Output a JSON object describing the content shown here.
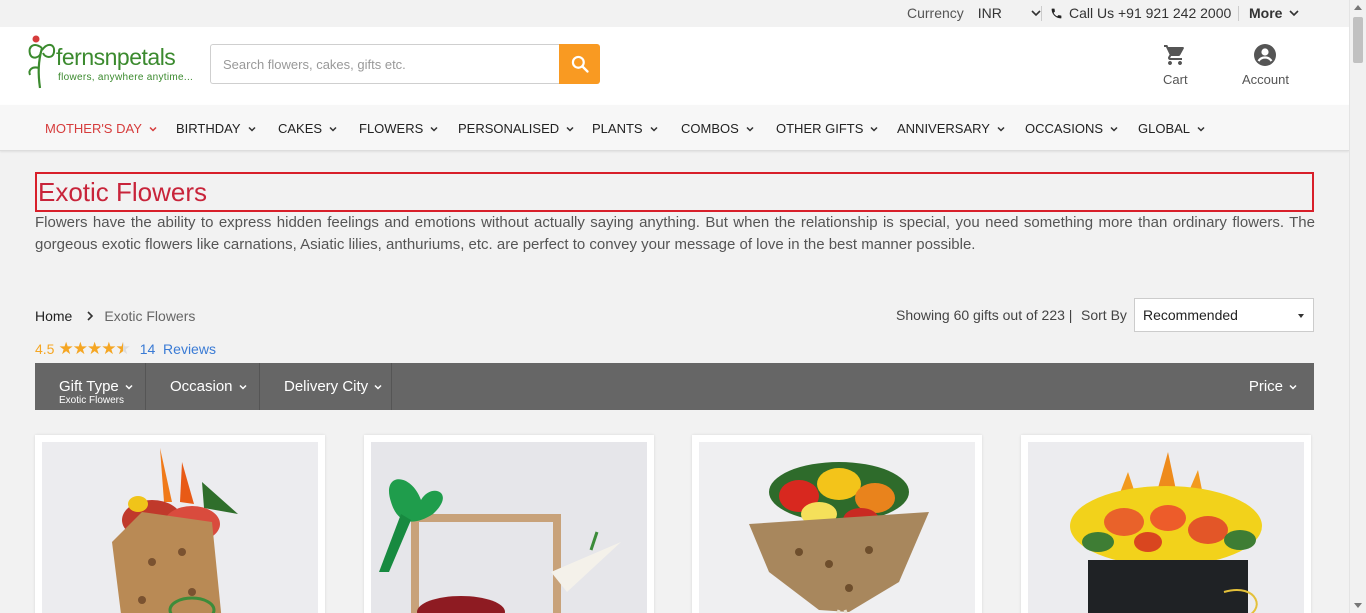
{
  "topbar": {
    "currency_label": "Currency",
    "currency_value": "INR",
    "call_label": "Call Us +91 921 242 2000",
    "more_label": "More"
  },
  "header": {
    "logo_name": "fernsnpetals",
    "logo_tagline": "flowers, anywhere anytime...",
    "search_placeholder": "Search flowers, cakes, gifts etc.",
    "cart_label": "Cart",
    "account_label": "Account"
  },
  "nav": {
    "items": [
      {
        "label": "MOTHER'S DAY"
      },
      {
        "label": "BIRTHDAY"
      },
      {
        "label": "CAKES"
      },
      {
        "label": "FLOWERS"
      },
      {
        "label": "PERSONALISED"
      },
      {
        "label": "PLANTS"
      },
      {
        "label": "COMBOS"
      },
      {
        "label": "OTHER GIFTS"
      },
      {
        "label": "ANNIVERSARY"
      },
      {
        "label": "OCCASIONS"
      },
      {
        "label": "GLOBAL"
      }
    ]
  },
  "page": {
    "title": "Exotic Flowers",
    "description": "Flowers have the ability to express hidden feelings and emotions without actually saying anything. But when the relationship is special, you need something more than ordinary flowers. The gorgeous exotic flowers like carnations, Asiatic lilies, anthuriums, etc. are perfect to convey your message of love in the best manner possible."
  },
  "breadcrumb": {
    "home": "Home",
    "current": "Exotic Flowers"
  },
  "rating": {
    "score": "4.5",
    "stars": 4.5,
    "review_count": "14",
    "reviews_label": "Reviews"
  },
  "listing": {
    "showing_text": "Showing 60 gifts out of 223 |",
    "sort_label": "Sort By",
    "sort_value": "Recommended"
  },
  "filters": {
    "gift_type": "Gift Type",
    "gift_type_value": "Exotic Flowers",
    "occasion": "Occasion",
    "delivery_city": "Delivery City",
    "price": "Price"
  },
  "colors": {
    "accent": "#f99a22",
    "title_red": "#c8243a",
    "nav_active": "#d63c3c",
    "filter_bar": "#666666",
    "brand_green": "#3b8a2e",
    "star": "#f5a623",
    "review_link": "#3a7bd5"
  },
  "icons": [
    "phone-icon",
    "chevron-down-icon",
    "search-icon",
    "cart-icon",
    "account-icon",
    "chevron-right-icon",
    "star-icon"
  ]
}
